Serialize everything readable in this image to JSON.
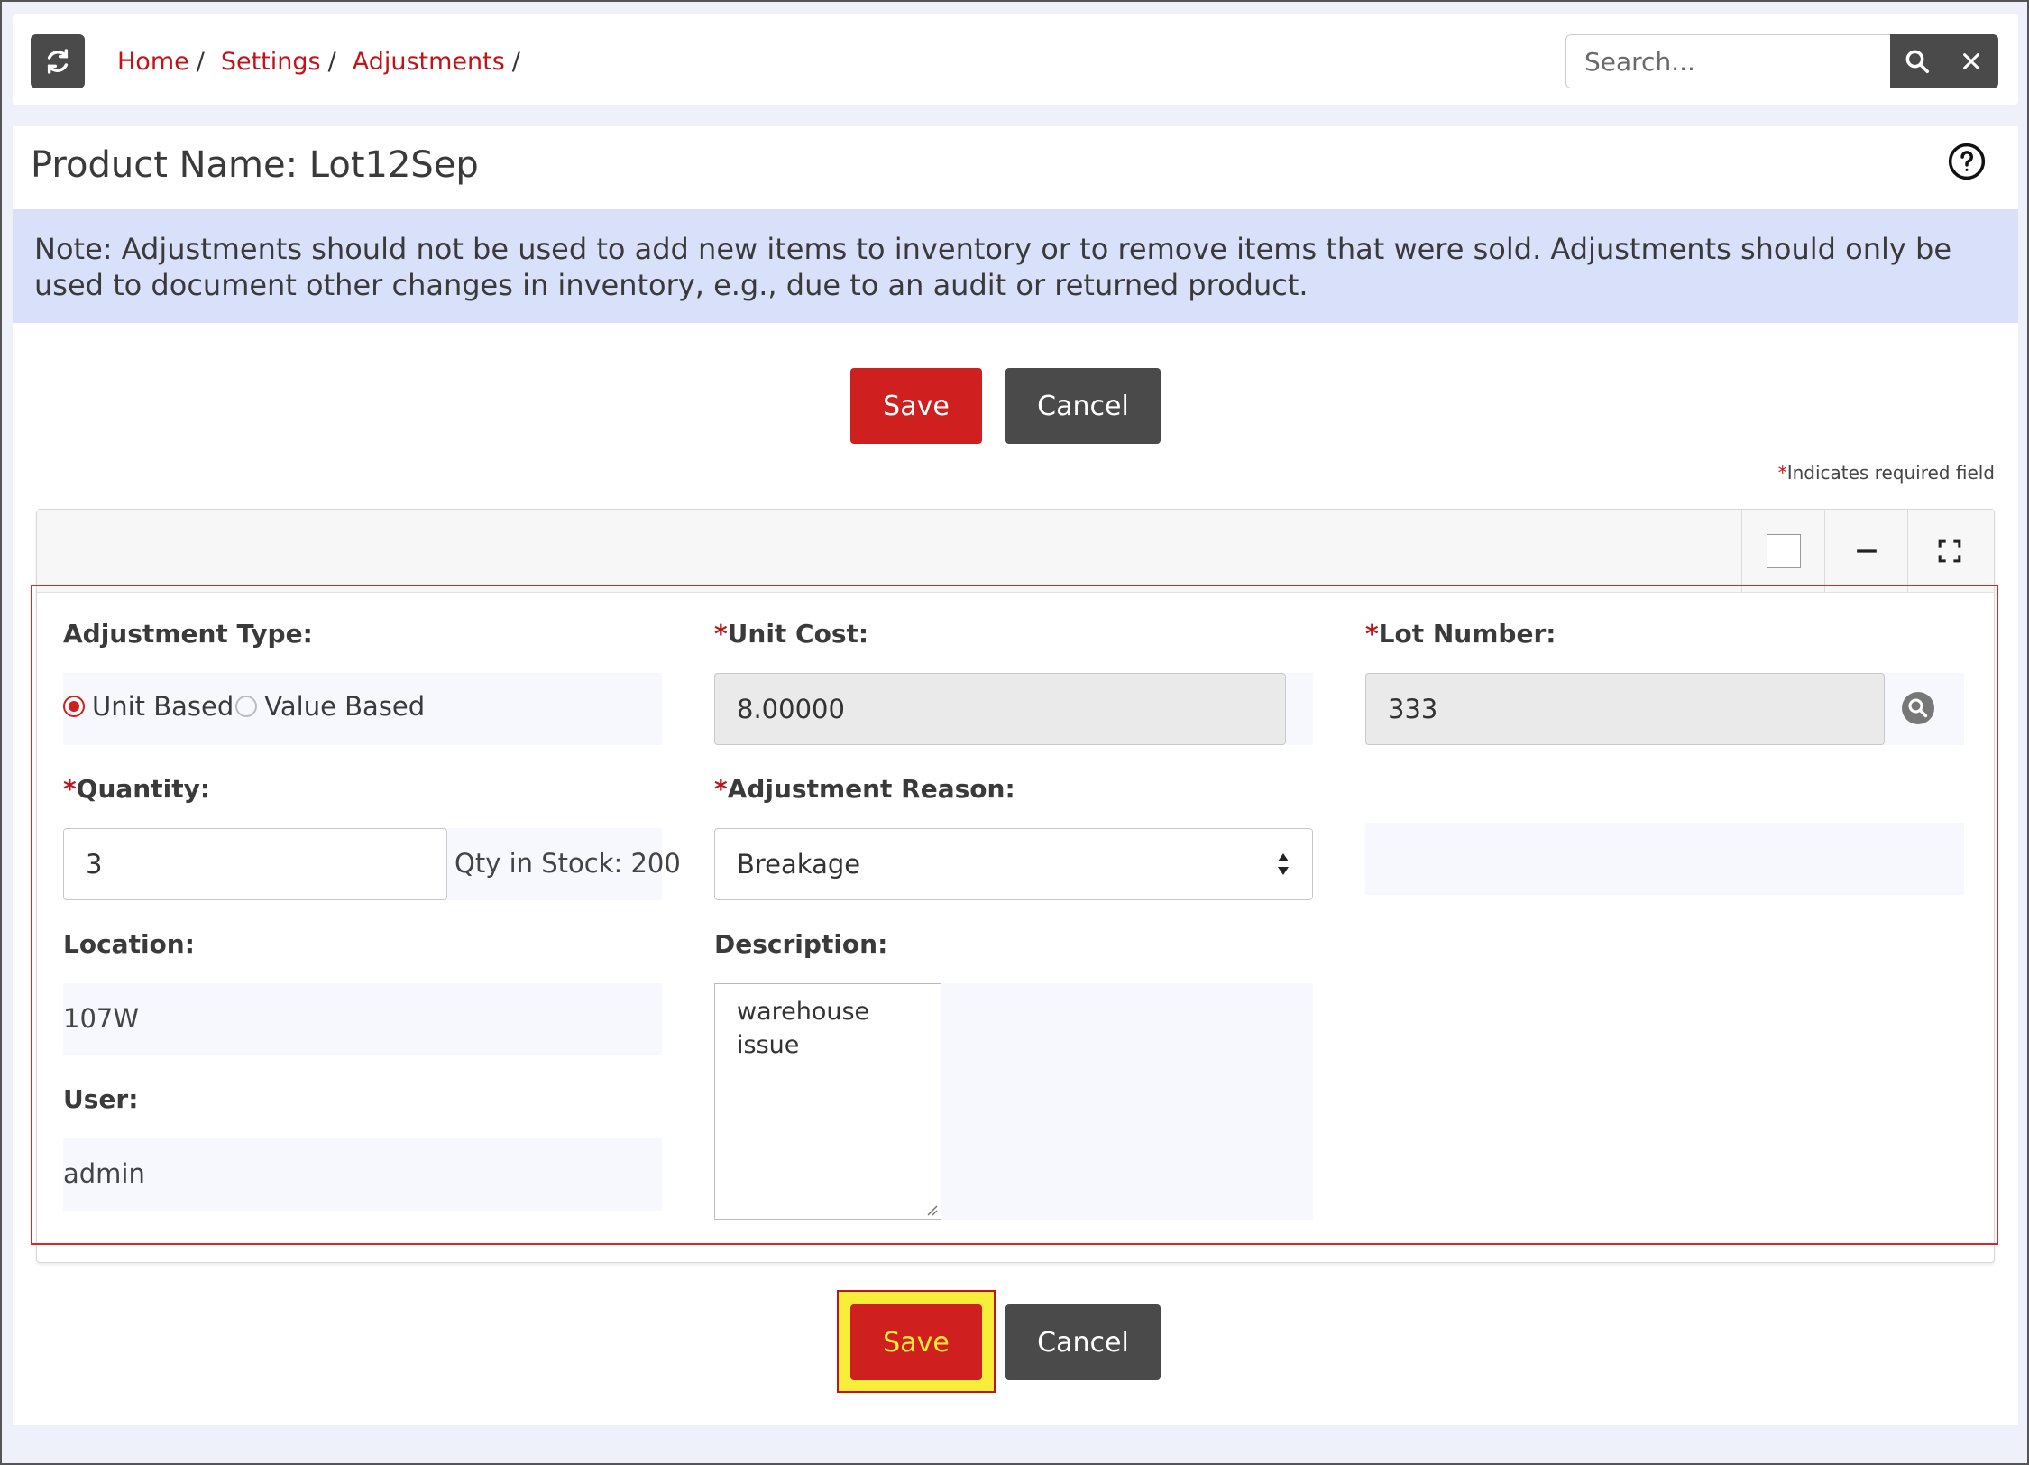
{
  "breadcrumb": [
    {
      "label": "Home"
    },
    {
      "label": "Settings"
    },
    {
      "label": "Adjustments"
    }
  ],
  "search": {
    "placeholder": "Search..."
  },
  "page": {
    "title": "Product Name: Lot12Sep",
    "note": "Note: Adjustments should not be used to add new items to inventory or to remove items that were sold. Adjustments should only be used to document other changes in inventory, e.g., due to an audit or returned product."
  },
  "actions": {
    "save_label": "Save",
    "cancel_label": "Cancel"
  },
  "required_note": "Indicates required field",
  "form": {
    "adjustment_type": {
      "label": "Adjustment Type:",
      "options": [
        "Unit Based",
        "Value Based"
      ],
      "selected": "Unit Based"
    },
    "unit_cost": {
      "label": "Unit Cost:",
      "value": "8.00000"
    },
    "lot_number": {
      "label": "Lot Number:",
      "value": "333"
    },
    "quantity": {
      "label": "Quantity:",
      "value": "3",
      "stock_text": "Qty in Stock: 200"
    },
    "adjustment_reason": {
      "label": "Adjustment Reason:",
      "value": "Breakage"
    },
    "location": {
      "label": "Location:",
      "value": "107W"
    },
    "description": {
      "label": "Description:",
      "value": "warehouse\nissue"
    },
    "user": {
      "label": "User:",
      "value": "admin"
    }
  },
  "colors": {
    "accent": "#cf1f1f",
    "dark": "#4a4a4a",
    "note_bg": "#d9e0fa",
    "link": "#c0141a"
  }
}
